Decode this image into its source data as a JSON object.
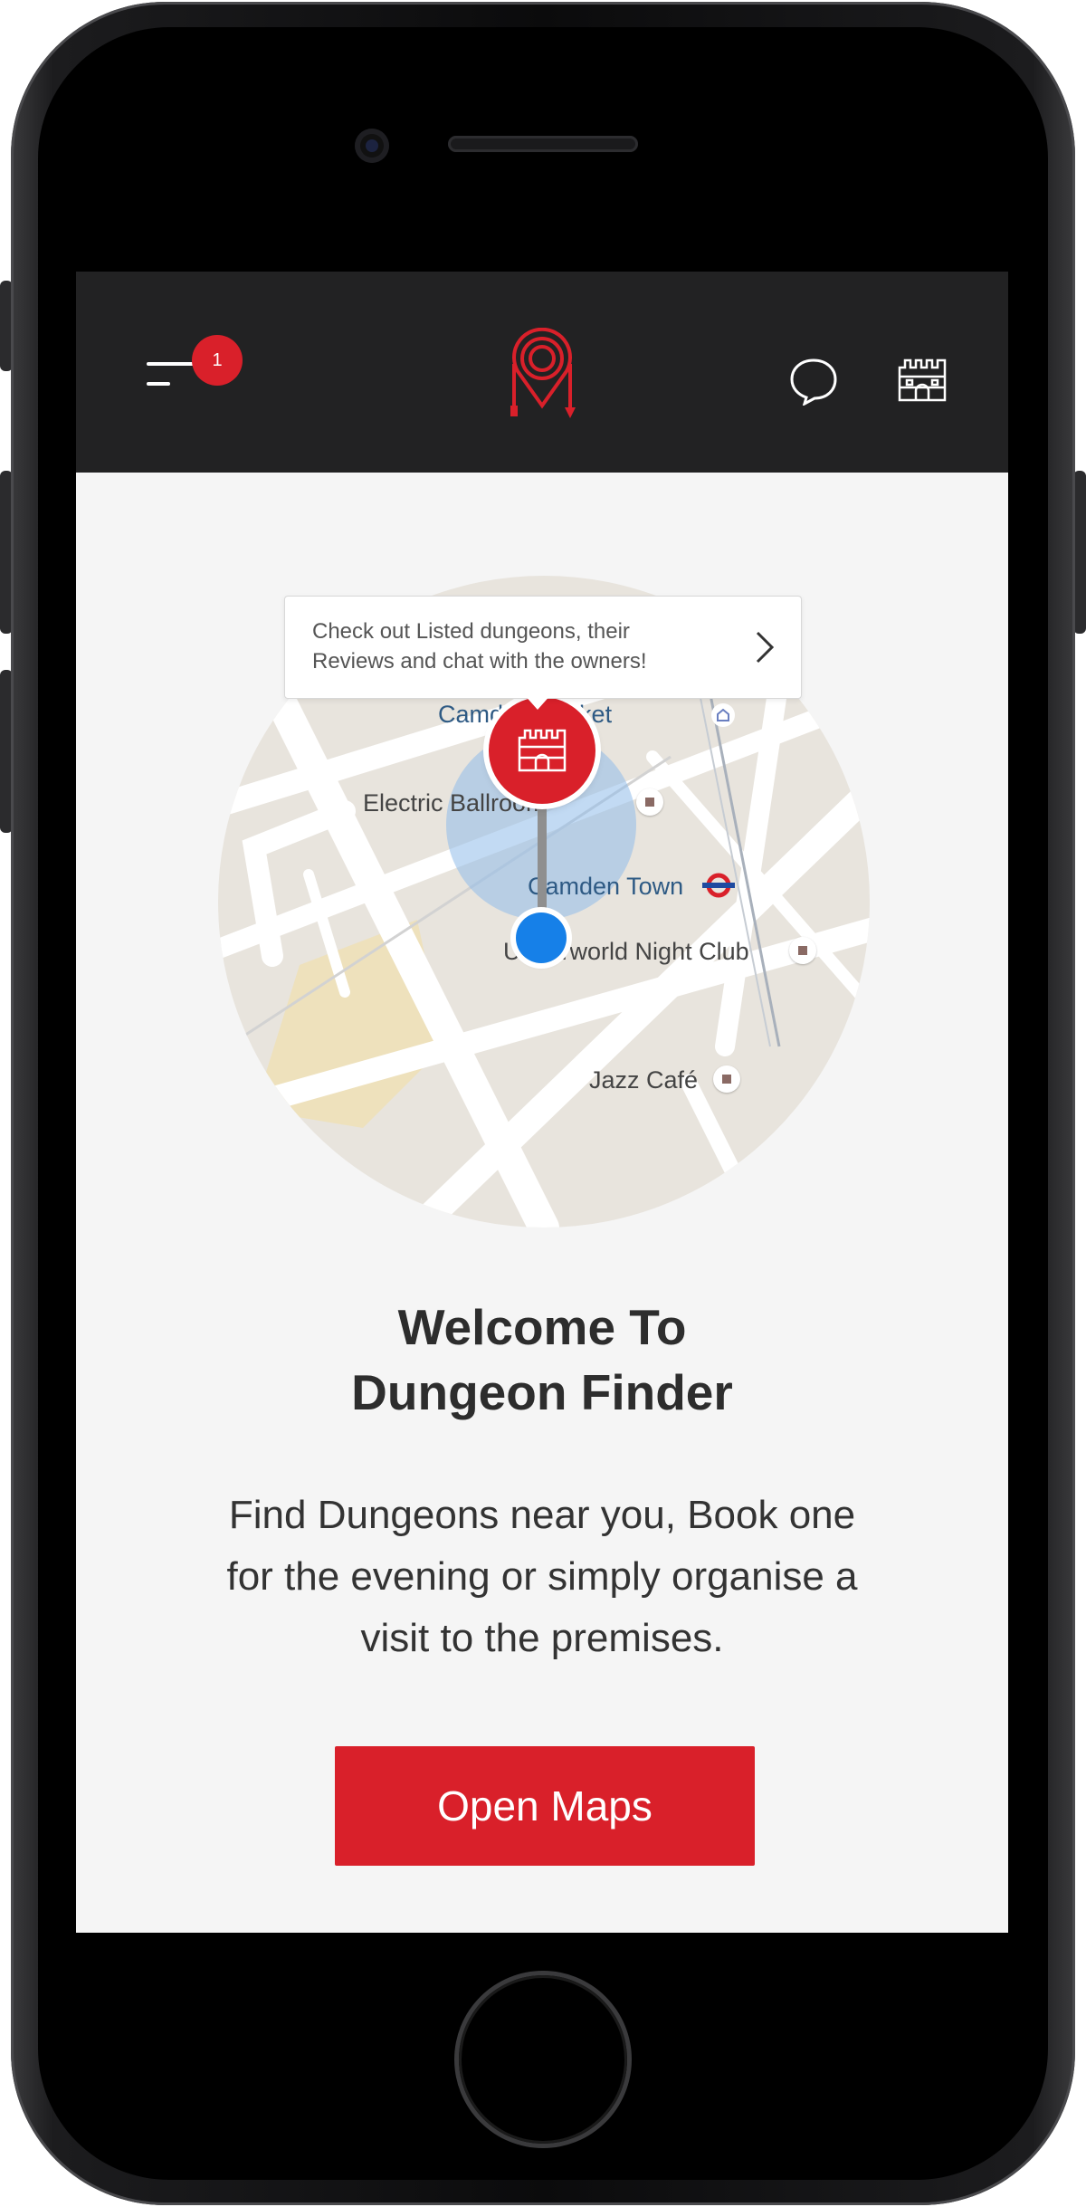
{
  "header": {
    "notification_count": "1",
    "icons": {
      "menu": "menu-icon",
      "logo": "dungeon-finder-logo",
      "chat": "chat-bubble-icon",
      "castle": "castle-icon"
    }
  },
  "map": {
    "tooltip_line1": "Check out Listed dungeons, their",
    "tooltip_line2": "Reviews and chat with the owners!",
    "labels": {
      "camden_market": "Camden Market",
      "electric_ballroom": "Electric Ballroom",
      "camden_town": "Camden Town",
      "underworld": "Underworld Night Club",
      "jazz_cafe": "Jazz Café"
    }
  },
  "content": {
    "title_line1": "Welcome To",
    "title_line2": "Dungeon Finder",
    "desc_line1": "Find Dungeons near you, Book one",
    "desc_line2": "for the evening or simply organise a",
    "desc_line3": "visit to the premises.",
    "cta_label": "Open Maps"
  },
  "colors": {
    "brand_red": "#d9202a",
    "nav_bg": "#222223",
    "screen_bg": "#f5f5f5",
    "user_blue": "#1680e8"
  }
}
